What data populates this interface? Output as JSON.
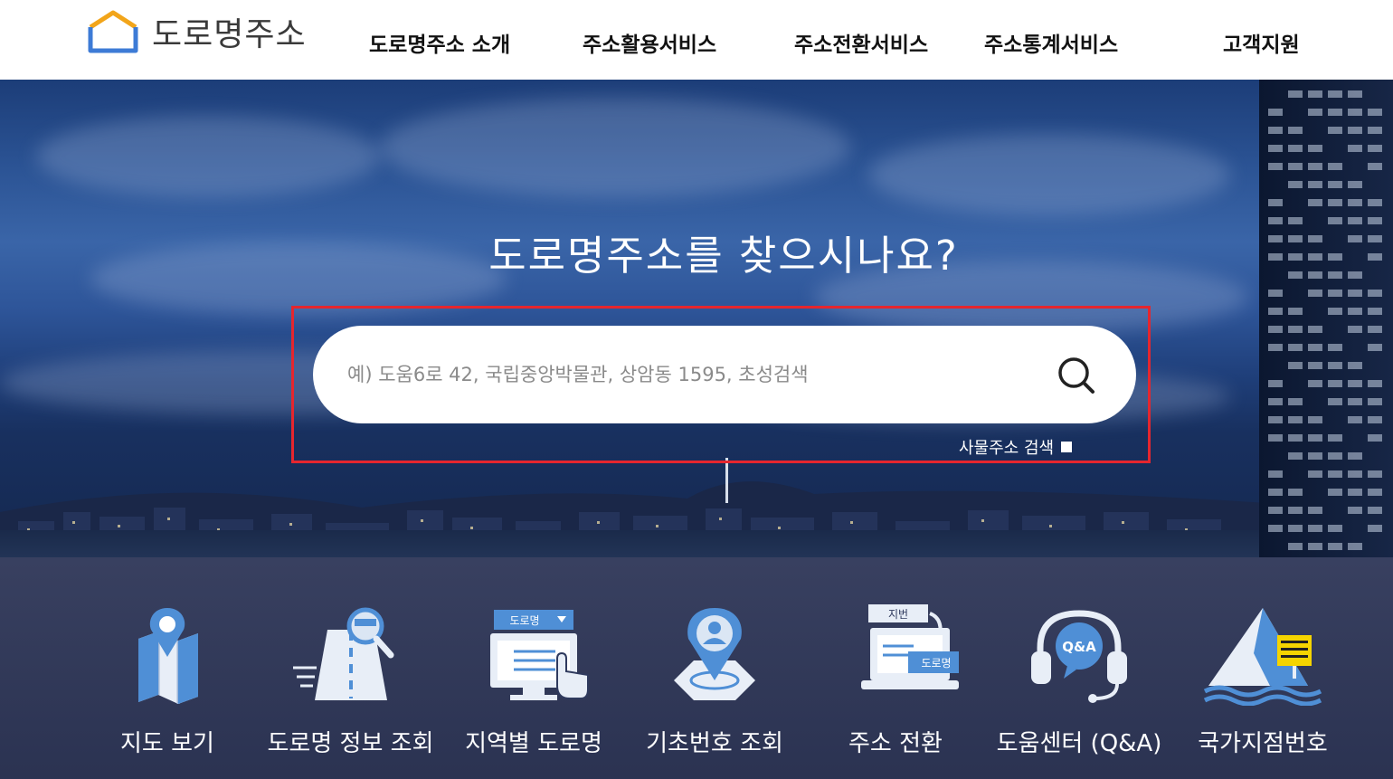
{
  "header": {
    "logo_text": "도로명주소",
    "nav": [
      {
        "label": "도로명주소 소개"
      },
      {
        "label": "주소활용서비스"
      },
      {
        "label": "주소전환서비스"
      },
      {
        "label": "주소통계서비스"
      },
      {
        "label": "고객지원"
      }
    ]
  },
  "hero": {
    "title": "도로명주소를 찾으시나요?",
    "search_placeholder": "예) 도움6로 42, 국립중앙박물관, 상암동 1595, 초성검색",
    "search_value": "",
    "thing_address_label": "사물주소 검색"
  },
  "icons": {
    "map_badge": "도로명",
    "convert_top": "지번",
    "convert_bottom": "도로명",
    "qa": "Q&A"
  },
  "services": [
    {
      "label": "지도 보기",
      "icon": "map-icon"
    },
    {
      "label": "도로명 정보 조회",
      "icon": "road-search-icon"
    },
    {
      "label": "지역별 도로명",
      "icon": "region-road-icon"
    },
    {
      "label": "기초번호 조회",
      "icon": "basic-number-icon"
    },
    {
      "label": "주소 전환",
      "icon": "address-convert-icon"
    },
    {
      "label": "도움센터 (Q&A)",
      "icon": "help-center-icon"
    },
    {
      "label": "국가지점번호",
      "icon": "national-point-icon"
    }
  ],
  "colors": {
    "accent_red": "#e5262e",
    "logo_blue": "#3d7bd6",
    "logo_orange": "#f2a51a",
    "icon_blue": "#4f8fd6"
  }
}
